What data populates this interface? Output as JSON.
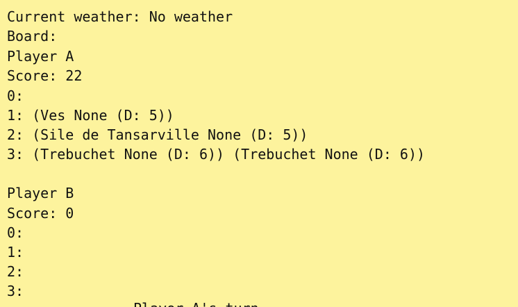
{
  "weather_line": "Current weather: No weather",
  "board_label": "Board:",
  "player_a": {
    "name": "Player A",
    "score": "Score: 22",
    "rows": [
      "0:",
      "1: (Ves None (D: 5))",
      "2: (Sile de Tansarville None (D: 5))",
      "3: (Trebuchet None (D: 6)) (Trebuchet None (D: 6))"
    ]
  },
  "player_b": {
    "name": "Player B",
    "score": "Score: 0",
    "rows": [
      "0:",
      "1:",
      "2:",
      "3:"
    ]
  },
  "turn_line": "Player A's turn"
}
